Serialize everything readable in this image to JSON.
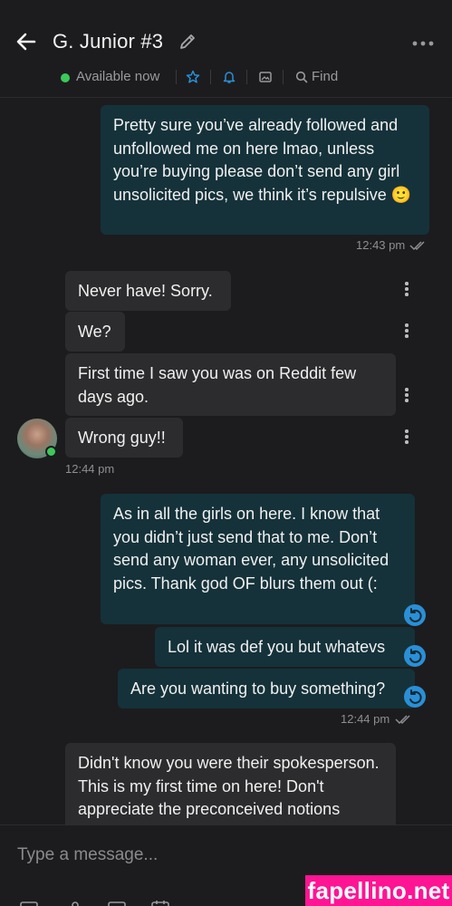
{
  "header": {
    "title": "G. Junior #3",
    "status": "Available now",
    "find_label": "Find"
  },
  "messages": [
    {
      "side": "out",
      "text": "Pretty sure you’ve already followed and unfollowed me on here lmao, unless you’re buying please don’t send any girl unsolicited pics, we think it’s repulsive 🙂"
    },
    {
      "side": "out_time",
      "text": "12:43 pm"
    },
    {
      "side": "in",
      "text": "Never have! Sorry."
    },
    {
      "side": "in",
      "text": "We?"
    },
    {
      "side": "in",
      "text": "First time I saw you was on Reddit few days ago."
    },
    {
      "side": "in",
      "text": "Wrong guy!!"
    },
    {
      "side": "in_time",
      "text": "12:44 pm"
    },
    {
      "side": "out",
      "text": "As in all the girls on here. I know that you didn’t just send that to me. Don’t send any woman ever, any unsolicit­ed pics. Thank god OF blurs them out (:"
    },
    {
      "side": "out",
      "text": "Lol it was def you but whatevs"
    },
    {
      "side": "out",
      "text": "Are you wanting to buy something?"
    },
    {
      "side": "out_time",
      "text": "12:44 pm"
    },
    {
      "side": "in",
      "text": "Didn't know you were their spokesper­son. This is my first time on here! Don't appreciate the preconceived notions"
    }
  ],
  "composer": {
    "placeholder": "Type a message..."
  },
  "watermark": "fapellino.net",
  "colors": {
    "background": "#1c1c1e",
    "outgoing_bubble": "#15323a",
    "incoming_bubble": "#2c2c2e",
    "online": "#3cc85a",
    "accent": "#2b8fd6",
    "watermark": "#ff1493"
  },
  "icons": [
    "back-arrow-icon",
    "edit-pencil-icon",
    "more-horizontal-icon",
    "star-icon",
    "bell-icon",
    "image-icon",
    "search-icon",
    "kebab-icon",
    "double-check-icon",
    "undo-icon"
  ]
}
